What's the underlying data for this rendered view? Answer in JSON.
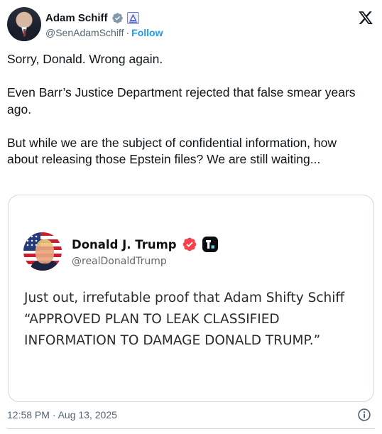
{
  "author": {
    "display_name": "Adam Schiff",
    "handle": "@SenAdamSchiff",
    "separator": "·",
    "follow_label": "Follow"
  },
  "post": {
    "paragraphs": [
      "Sorry, Donald. Wrong again.",
      "Even Barr’s Justice Department rejected that false smear years ago.",
      "But while we are the subject of confidential information, how about releasing those Epstein files? We are still waiting..."
    ]
  },
  "quoted": {
    "display_name": "Donald J. Trump",
    "handle": "@realDonaldTrump",
    "text": "Just out, irrefutable proof that Adam Shifty Schiff “APPROVED PLAN TO LEAK CLASSIFIED INFORMATION TO DAMAGE DONALD TRUMP.”"
  },
  "footer": {
    "timestamp": "12:58 PM · Aug 13, 2025"
  },
  "icons": {
    "platform": "x-logo-icon",
    "verified": "verified-badge-icon",
    "affiliation": "government-badge-icon",
    "quoted_verified": "truth-verified-icon",
    "quoted_badge": "truth-social-icon",
    "info": "info-icon"
  },
  "colors": {
    "link": "#1d9bf0",
    "verified_gray": "#829aab",
    "truth_verified": "#f5424b",
    "text_primary": "#0f1419",
    "text_secondary": "#536471",
    "border": "#cfd9de"
  }
}
